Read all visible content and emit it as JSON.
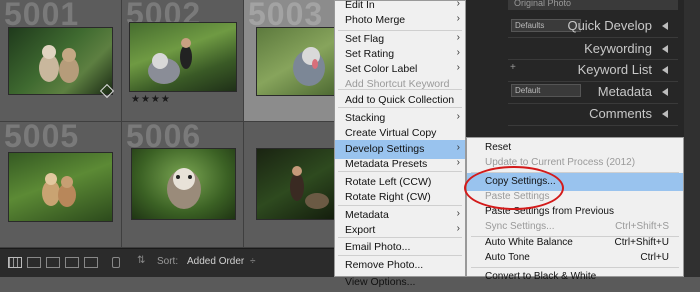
{
  "grid": {
    "cells": [
      {
        "number": "5001",
        "stars": "",
        "selected": false
      },
      {
        "number": "5002",
        "stars": "★★★★",
        "selected": false
      },
      {
        "number": "5003",
        "stars": "",
        "selected": true
      },
      {
        "number": "5005",
        "stars": "",
        "selected": false
      },
      {
        "number": "5006",
        "stars": "",
        "selected": false
      },
      {
        "number": "",
        "stars": "",
        "selected": false
      }
    ]
  },
  "toolbar": {
    "sort_label": "Sort:",
    "sort_value": "Added Order",
    "sort_arrow": "÷"
  },
  "right_panel": {
    "original_photo": "Original Photo",
    "defaults_select": "Defaults",
    "quick_develop": "Quick Develop",
    "keywording": "Keywording",
    "keyword_list": "Keyword List",
    "metadata_select": "Default",
    "metadata": "Metadata",
    "comments": "Comments"
  },
  "context_menu": {
    "items": [
      {
        "label": "Edit In",
        "arrow": "›",
        "disabled": false
      },
      {
        "label": "Photo Merge",
        "arrow": "›",
        "disabled": false
      },
      {
        "label": "Set Flag",
        "arrow": "›",
        "disabled": false
      },
      {
        "label": "Set Rating",
        "arrow": "›",
        "disabled": false
      },
      {
        "label": "Set Color Label",
        "arrow": "›",
        "disabled": false
      },
      {
        "label": "Add Shortcut Keyword",
        "arrow": "",
        "disabled": true
      },
      {
        "label": "Add to Quick Collection",
        "arrow": "",
        "disabled": false
      },
      {
        "label": "Stacking",
        "arrow": "›",
        "disabled": false
      },
      {
        "label": "Create Virtual Copy",
        "arrow": "",
        "disabled": false
      },
      {
        "label": "Develop Settings",
        "arrow": "›",
        "disabled": false
      },
      {
        "label": "Metadata Presets",
        "arrow": "›",
        "disabled": false
      },
      {
        "label": "Rotate Left (CCW)",
        "arrow": "",
        "disabled": false
      },
      {
        "label": "Rotate Right (CW)",
        "arrow": "",
        "disabled": false
      },
      {
        "label": "Metadata",
        "arrow": "›",
        "disabled": false
      },
      {
        "label": "Export",
        "arrow": "›",
        "disabled": false
      },
      {
        "label": "Email Photo...",
        "arrow": "",
        "disabled": false
      },
      {
        "label": "Remove Photo...",
        "arrow": "",
        "disabled": false
      },
      {
        "label": "View Options...",
        "arrow": "",
        "disabled": false
      }
    ]
  },
  "submenu": {
    "items": [
      {
        "label": "Reset",
        "shortcut": "",
        "disabled": false
      },
      {
        "label": "Update to Current Process (2012)",
        "shortcut": "",
        "disabled": true
      },
      {
        "label": "Copy Settings...",
        "shortcut": "",
        "disabled": false
      },
      {
        "label": "Paste Settings",
        "shortcut": "",
        "disabled": true
      },
      {
        "label": "Paste Settings from Previous",
        "shortcut": "",
        "disabled": false
      },
      {
        "label": "Sync Settings...",
        "shortcut": "Ctrl+Shift+S",
        "disabled": true
      },
      {
        "label": "Auto White Balance",
        "shortcut": "Ctrl+Shift+U",
        "disabled": false
      },
      {
        "label": "Auto Tone",
        "shortcut": "Ctrl+U",
        "disabled": false
      },
      {
        "label": "Convert to Black & White",
        "shortcut": "",
        "disabled": false
      }
    ]
  }
}
